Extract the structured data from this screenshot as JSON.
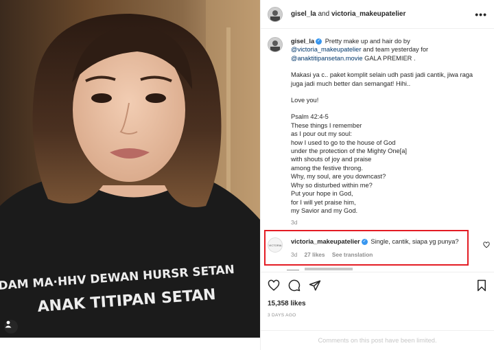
{
  "header": {
    "user1": "gisel_la",
    "and": "and",
    "user2": "victoria_makeupatelier",
    "more": "•••"
  },
  "caption": {
    "username": "gisel_la",
    "text1": "Pretty make up and hair do by",
    "mention1": "@victoria_makeupatelier",
    "text2": "and team yesterday for",
    "mention2": "@anaktitipansetan.movie",
    "text3": "GALA PREMIER .",
    "para2": "Makasi ya c.. paket komplit selain udh pasti jadi cantik, jiwa raga juga jadi much better dan semangat! Hihi..",
    "para3": "Love you!",
    "psalm_lines": [
      "Psalm 42:4-5",
      "These things I remember",
      "as I pour out my soul:",
      "how I used to go to the house of God",
      "under the protection of the Mighty One[a]",
      "with shouts of joy and praise",
      "among the festive throng.",
      "Why, my soul, are you downcast?",
      "Why so disturbed within me?",
      "Put your hope in God,",
      "for I will yet praise him,",
      "my Savior and my God."
    ],
    "time": "3d"
  },
  "comment": {
    "username": "victoria_makeupatelier",
    "avatar_text": "VICTORIA",
    "text": "Single, cantik, siapa yg punya?",
    "time": "3d",
    "likes": "27 likes",
    "translate": "See translation"
  },
  "post": {
    "likes": "15,358 likes",
    "date": "3 DAYS AGO",
    "limited_notice": "Comments on this post have been limited."
  },
  "photo": {
    "shirt_line1": "DAM MA·HHV DEWAN HURSR SETAN",
    "shirt_line2": "ANAK TITIPAN SETAN"
  },
  "icons": {
    "like": "heart-icon",
    "comment": "comment-icon",
    "share": "share-icon",
    "save": "bookmark-icon",
    "verified": "verified-badge-icon"
  },
  "colors": {
    "highlight": "#e31b23",
    "verified": "#3897f0",
    "mention": "#00376b",
    "muted": "#8e8e8e"
  }
}
